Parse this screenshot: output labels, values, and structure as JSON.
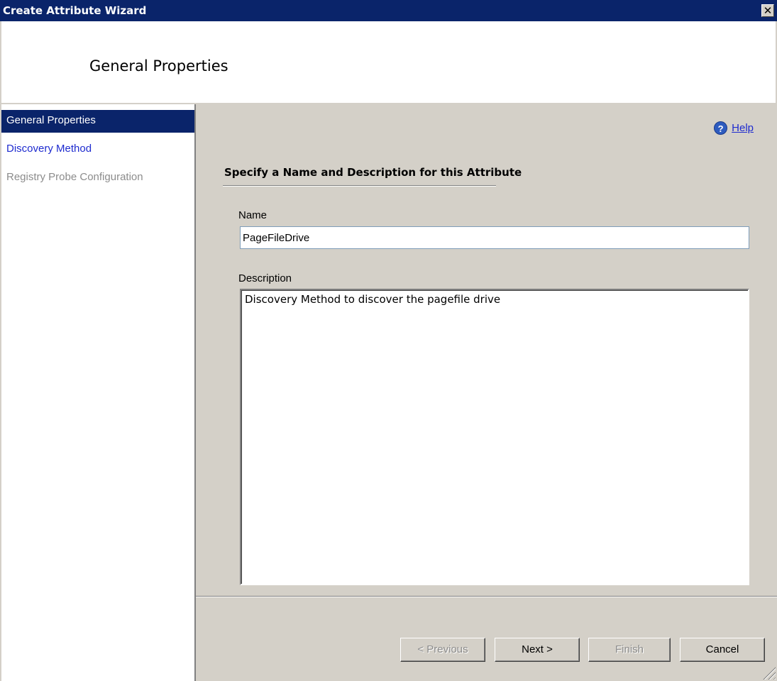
{
  "window": {
    "title": "Create Attribute Wizard",
    "close_glyph": "✕"
  },
  "header": {
    "title": "General Properties"
  },
  "nav": {
    "items": [
      {
        "label": "General Properties",
        "state": "active"
      },
      {
        "label": "Discovery Method",
        "state": "link"
      },
      {
        "label": "Registry Probe Configuration",
        "state": "disabled"
      }
    ]
  },
  "content": {
    "help": {
      "icon": "question-icon",
      "icon_glyph": "?",
      "label": "Help"
    },
    "section_title": "Specify a Name and Description for this Attribute",
    "name_label": "Name",
    "name_value": "PageFileDrive",
    "description_label": "Description",
    "description_value": "Discovery Method to discover the pagefile drive"
  },
  "buttons": {
    "previous": "< Previous",
    "next": "Next >",
    "finish": "Finish",
    "cancel": "Cancel"
  },
  "colors": {
    "titlebar": "#0a246a",
    "link": "#1e2bcf",
    "disabled": "#8c8c8c",
    "face": "#d4d0c8"
  }
}
